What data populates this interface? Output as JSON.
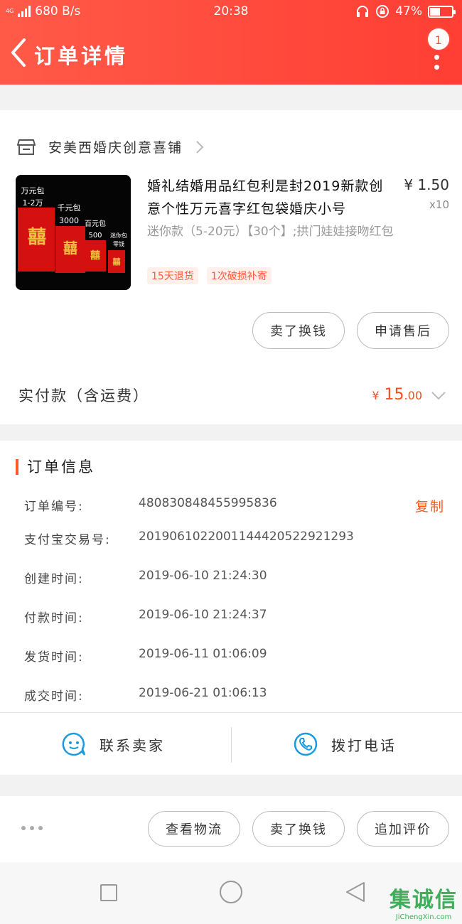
{
  "status_bar": {
    "network": "4G",
    "speed": "680 B/s",
    "time": "20:38",
    "battery": "47%",
    "battery_level": 0.47
  },
  "header": {
    "title": "订单详情",
    "badge": "1"
  },
  "shop": {
    "name": "安美西婚庆创意喜铺"
  },
  "product": {
    "name": "婚礼结婚用品红包利是封2019新款创意个性万元喜字红包袋婚庆小号",
    "spec": "迷你款（5-20元）【30个】;拱门娃娃接吻红包",
    "price": "¥ 1.50",
    "quantity": "x10",
    "tags": [
      "15天退货",
      "1次破损补寄"
    ],
    "image_labels": [
      "万元包",
      "1-2万",
      "千元包",
      "3000",
      "百元包",
      "500",
      "迷你包",
      "零钱"
    ]
  },
  "item_actions": {
    "exchange": "卖了换钱",
    "after_sale": "申请售后"
  },
  "payment": {
    "label": "实付款（含运费）",
    "currency": "¥",
    "amount_int": "15",
    "amount_dec": ".00"
  },
  "order_info": {
    "title": "订单信息",
    "copy_label": "复制",
    "rows": [
      {
        "key": "订单编号:",
        "value": "480830848455995836"
      },
      {
        "key": "支付宝交易号:",
        "value": "2019061022001144420522921293"
      },
      {
        "key": "创建时间:",
        "value": "2019-06-10 21:24:30"
      },
      {
        "key": "付款时间:",
        "value": "2019-06-10 21:24:37"
      },
      {
        "key": "发货时间:",
        "value": "2019-06-11 01:06:09"
      },
      {
        "key": "成交时间:",
        "value": "2019-06-21 01:06:13"
      }
    ]
  },
  "contact": {
    "seller": "联系卖家",
    "phone": "拨打电话"
  },
  "bottom_actions": {
    "logistics": "查看物流",
    "exchange": "卖了换钱",
    "review": "追加评价"
  },
  "watermark": {
    "brand": "集诚信",
    "site": "JiChengXin.com"
  },
  "colors": {
    "header": "#ff4a3c",
    "accent": "#ff5a1a",
    "icon_blue": "#1a9ae0"
  }
}
